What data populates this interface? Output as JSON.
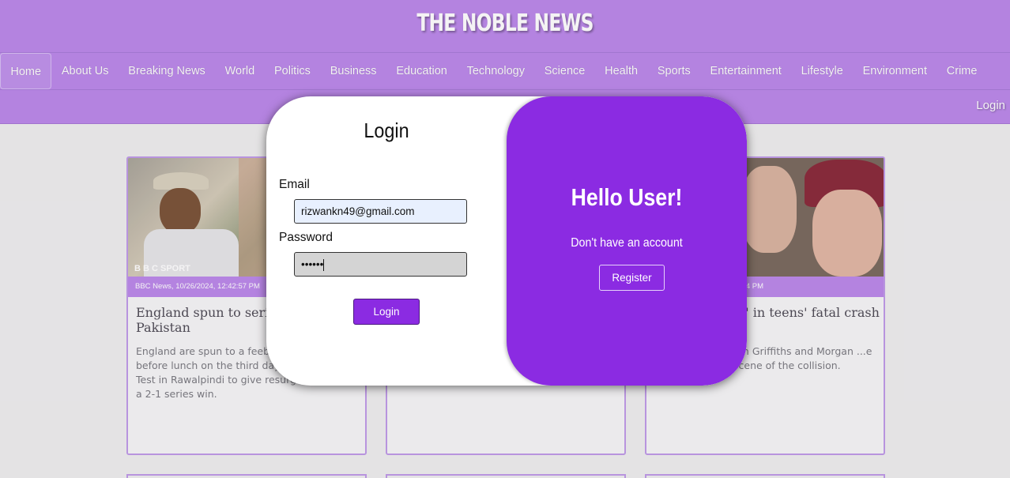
{
  "site": {
    "brand": "THE NOBLE NEWS",
    "login_link": "Login"
  },
  "nav": [
    "Home",
    "About Us",
    "Breaking News",
    "World",
    "Politics",
    "Business",
    "Education",
    "Technology",
    "Science",
    "Health",
    "Sports",
    "Entertainment",
    "Lifestyle",
    "Environment",
    "Crime"
  ],
  "cards": [
    {
      "meta": "BBC News, 10/26/2024, 12:42:57 PM",
      "title": "England spun to series defeat in Pakistan",
      "body": "England are spun to a feeble 152-run defeat before lunch on the third day of the third Test in Rawalpindi to give resurgent Pakistan a 2-1 series win.",
      "image_watermark": "B B C SPORT"
    },
    {
      "meta": "",
      "title": "",
      "body": ""
    },
    {
      "meta": "...:04 PM",
      "title": "...' in teens' fatal crash",
      "body": "...n Griffiths and Morgan ...e scene of the collision."
    }
  ],
  "modal": {
    "title": "Login",
    "email_label": "Email",
    "email_value": "rizwankn49@gmail.com",
    "password_label": "Password",
    "password_value": "••••••",
    "login_button": "Login",
    "hello": "Hello User!",
    "no_account": "Don't have an account",
    "register_button": "Register"
  },
  "colors": {
    "header": "#bb89ea",
    "accent": "#8b2be2",
    "background": "#efeeef"
  }
}
